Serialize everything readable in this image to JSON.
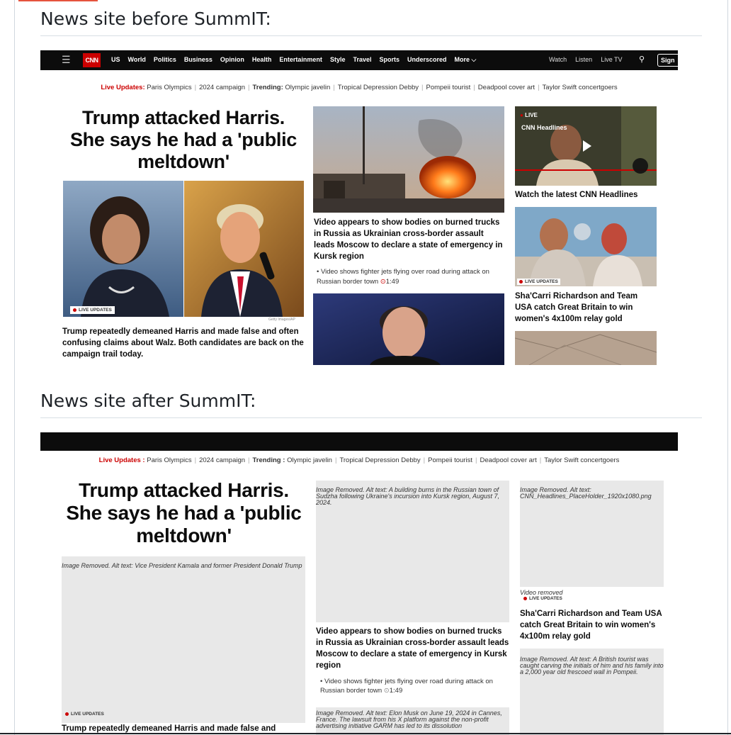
{
  "headings": {
    "before": "News site before SummIT:",
    "after": "News site after SummIT:"
  },
  "nav": {
    "logo": "CNN",
    "links": [
      "US",
      "World",
      "Politics",
      "Business",
      "Opinion",
      "Health",
      "Entertainment",
      "Style",
      "Travel",
      "Sports",
      "Underscored",
      "More ⌵"
    ],
    "right_links": [
      "Watch",
      "Listen",
      "Live TV"
    ],
    "sign_in": "Sign"
  },
  "ticker": {
    "live_label": "Live Updates:",
    "live_label_after": "Live Updates",
    "live_item": "Paris Olympics",
    "items": [
      "2024 campaign"
    ],
    "trending_label": "Trending:",
    "trending_label_after": "Trending",
    "trending_items": [
      "Olympic javelin",
      "Tropical Depression Debby",
      "Pompeii tourist",
      "Deadpool cover art",
      "Taylor Swift concertgoers"
    ]
  },
  "main": {
    "headline": "Trump attacked Harris. She says he had a 'public meltdown'",
    "live_updates": "LIVE UPDATES",
    "photo_credit": "Getty Images/AP",
    "summary": "Trump repeatedly demeaned Harris and made false and often confusing claims about Walz. Both candidates are back on the campaign trail today.",
    "summary_after": "Trump repeatedly demeaned Harris and made false and"
  },
  "middle": {
    "story": "Video appears to show bodies on burned trucks in Russia as Ukrainian cross-border assault leads Moscow to declare a state of emergency in Kursk region",
    "sub": "Video shows fighter jets flying over road during attack on Russian border town",
    "duration": "1:49"
  },
  "right": {
    "live": "LIVE",
    "video_title": "CNN Headlines",
    "watch_caption": "Watch the latest CNN Headlines",
    "live_updates": "LIVE UPDATES",
    "relay_story": "Sha'Carri Richardson and Team USA catch Great Britain to win women's 4x100m relay gold"
  },
  "alt_texts": {
    "main": "Image Removed. Alt text: Vice President Kamala and former President Donald Trump",
    "fire": "Image Removed. Alt text: A building burns in the Russian town of Sudzha following Ukraine's incursion into Kursk region, August 7, 2024.",
    "video": "Image Removed. Alt text: CNN_Headlines_PlaceHolder_1920x1080.png",
    "video_removed": "Video removed",
    "pompeii": "Image Removed. Alt text: A British tourist was caught carving the initials of him and his family into a 2,000 year old frescoed wall in Pompeii.",
    "musk": "Image Removed. Alt text: Elon Musk on June 19, 2024 in Cannes, France. The lawsuit from his X platform against the non-profit advertising initiative GARM has led to its dissolution"
  }
}
